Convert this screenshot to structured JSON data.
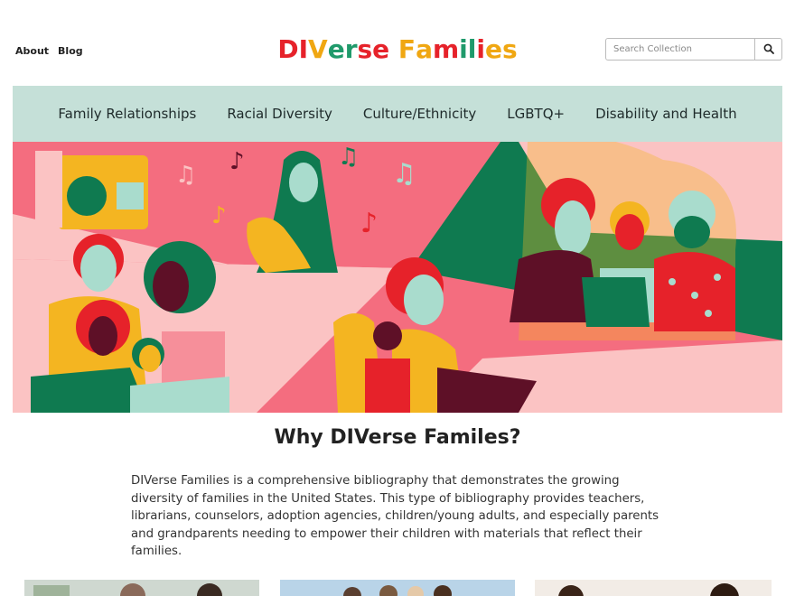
{
  "header": {
    "links": [
      {
        "label": "About"
      },
      {
        "label": "Blog"
      }
    ],
    "logo": {
      "letters": [
        {
          "ch": "D",
          "color": "#e6222a"
        },
        {
          "ch": "I",
          "color": "#e6222a"
        },
        {
          "ch": "V",
          "color": "#f0a712"
        },
        {
          "ch": "e",
          "color": "#1f9a6b"
        },
        {
          "ch": "r",
          "color": "#1f9a6b"
        },
        {
          "ch": "s",
          "color": "#e6222a"
        },
        {
          "ch": "e",
          "color": "#e6222a"
        },
        {
          "ch": " ",
          "color": "#ffffff"
        },
        {
          "ch": "F",
          "color": "#f0a712"
        },
        {
          "ch": "a",
          "color": "#f0a712"
        },
        {
          "ch": "m",
          "color": "#e6222a"
        },
        {
          "ch": "i",
          "color": "#1f9a6b"
        },
        {
          "ch": "l",
          "color": "#1f9a6b"
        },
        {
          "ch": "i",
          "color": "#e6222a"
        },
        {
          "ch": "e",
          "color": "#f0a712"
        },
        {
          "ch": "s",
          "color": "#f0a712"
        }
      ]
    },
    "search": {
      "placeholder": "Search Collection",
      "value": "",
      "icon": "search-icon"
    }
  },
  "nav": {
    "items": [
      {
        "label": "Family Relationships"
      },
      {
        "label": "Racial Diversity"
      },
      {
        "label": "Culture/Ethnicity"
      },
      {
        "label": "LGBTQ+"
      },
      {
        "label": "Disability and Health"
      }
    ]
  },
  "main": {
    "title": "Why DIVerse Familes?",
    "body": "DIVerse Families is a comprehensive bibliography that demonstrates the growing diversity of families in the United States. This type of bibliography provides teachers, librarians, counselors, adoption agencies, children/young adults, and especially parents and grandparents needing to empower their children with materials that reflect their families."
  },
  "colors": {
    "nav_bg": "#c5e0d8",
    "hero_pink": "#f46d7f",
    "hero_light_pink": "#fbc3c3",
    "hero_green": "#0f7a50",
    "hero_yellow": "#f4b521",
    "hero_red": "#e6222a",
    "hero_maroon": "#5e1027",
    "hero_mint": "#a9dccd"
  }
}
